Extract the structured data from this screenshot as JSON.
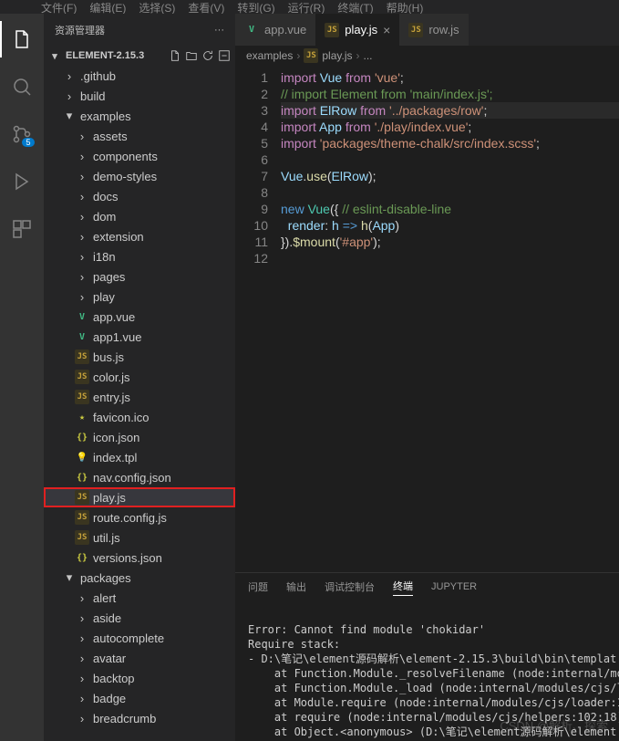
{
  "menubar": [
    "文件(F)",
    "编辑(E)",
    "选择(S)",
    "查看(V)",
    "转到(G)",
    "运行(R)",
    "终端(T)",
    "帮助(H)"
  ],
  "sidebar": {
    "title": "资源管理器",
    "root": "ELEMENT-2.15.3",
    "scm_badge": "5"
  },
  "tree": [
    {
      "depth": 1,
      "kind": "folder",
      "open": false,
      "label": ".github"
    },
    {
      "depth": 1,
      "kind": "folder",
      "open": false,
      "label": "build"
    },
    {
      "depth": 1,
      "kind": "folder",
      "open": true,
      "label": "examples"
    },
    {
      "depth": 2,
      "kind": "folder",
      "open": false,
      "label": "assets"
    },
    {
      "depth": 2,
      "kind": "folder",
      "open": false,
      "label": "components"
    },
    {
      "depth": 2,
      "kind": "folder",
      "open": false,
      "label": "demo-styles"
    },
    {
      "depth": 2,
      "kind": "folder",
      "open": false,
      "label": "docs"
    },
    {
      "depth": 2,
      "kind": "folder",
      "open": false,
      "label": "dom"
    },
    {
      "depth": 2,
      "kind": "folder",
      "open": false,
      "label": "extension"
    },
    {
      "depth": 2,
      "kind": "folder",
      "open": false,
      "label": "i18n"
    },
    {
      "depth": 2,
      "kind": "folder",
      "open": false,
      "label": "pages"
    },
    {
      "depth": 2,
      "kind": "folder",
      "open": false,
      "label": "play"
    },
    {
      "depth": 2,
      "kind": "file",
      "icon": "vue",
      "label": "app.vue"
    },
    {
      "depth": 2,
      "kind": "file",
      "icon": "vue",
      "label": "app1.vue"
    },
    {
      "depth": 2,
      "kind": "file",
      "icon": "js",
      "label": "bus.js"
    },
    {
      "depth": 2,
      "kind": "file",
      "icon": "js",
      "label": "color.js"
    },
    {
      "depth": 2,
      "kind": "file",
      "icon": "js",
      "label": "entry.js"
    },
    {
      "depth": 2,
      "kind": "file",
      "icon": "ico",
      "label": "favicon.ico"
    },
    {
      "depth": 2,
      "kind": "file",
      "icon": "json",
      "label": "icon.json"
    },
    {
      "depth": 2,
      "kind": "file",
      "icon": "bulb",
      "label": "index.tpl"
    },
    {
      "depth": 2,
      "kind": "file",
      "icon": "json",
      "label": "nav.config.json"
    },
    {
      "depth": 2,
      "kind": "file",
      "icon": "js",
      "label": "play.js",
      "selected": true,
      "boxed": true
    },
    {
      "depth": 2,
      "kind": "file",
      "icon": "js",
      "label": "route.config.js"
    },
    {
      "depth": 2,
      "kind": "file",
      "icon": "js",
      "label": "util.js"
    },
    {
      "depth": 2,
      "kind": "file",
      "icon": "json",
      "label": "versions.json"
    },
    {
      "depth": 1,
      "kind": "folder",
      "open": true,
      "label": "packages"
    },
    {
      "depth": 2,
      "kind": "folder",
      "open": false,
      "label": "alert"
    },
    {
      "depth": 2,
      "kind": "folder",
      "open": false,
      "label": "aside"
    },
    {
      "depth": 2,
      "kind": "folder",
      "open": false,
      "label": "autocomplete"
    },
    {
      "depth": 2,
      "kind": "folder",
      "open": false,
      "label": "avatar"
    },
    {
      "depth": 2,
      "kind": "folder",
      "open": false,
      "label": "backtop"
    },
    {
      "depth": 2,
      "kind": "folder",
      "open": false,
      "label": "badge"
    },
    {
      "depth": 2,
      "kind": "folder",
      "open": false,
      "label": "breadcrumb"
    }
  ],
  "tabs": [
    {
      "icon": "vue",
      "label": "app.vue",
      "active": false
    },
    {
      "icon": "js",
      "label": "play.js",
      "active": true,
      "close": true
    },
    {
      "icon": "js",
      "label": "row.js",
      "active": false
    }
  ],
  "breadcrumbs": [
    "examples",
    "play.js",
    "..."
  ],
  "code_lines": [
    {
      "n": 1,
      "html": "<span class='k-import'>import</span> <span class='k-var'>Vue</span> <span class='k-from'>from</span> <span class='k-str'>'vue'</span><span class='k-pun'>;</span>"
    },
    {
      "n": 2,
      "html": "<span class='k-com'>// import Element from 'main/index.js';</span>"
    },
    {
      "n": 3,
      "current": true,
      "html": "<span class='k-import'>import</span> <span class='k-var'>ElRow</span> <span class='k-from'>from</span> <span class='k-str'>'../packages/row'</span><span class='k-pun'>;</span>"
    },
    {
      "n": 4,
      "html": "<span class='k-import'>import</span> <span class='k-var'>App</span> <span class='k-from'>from</span> <span class='k-str'>'./play/index.vue'</span><span class='k-pun'>;</span>"
    },
    {
      "n": 5,
      "html": "<span class='k-import'>import</span> <span class='k-str'>'packages/theme-chalk/src/index.scss'</span><span class='k-pun'>;</span>"
    },
    {
      "n": 6,
      "html": ""
    },
    {
      "n": 7,
      "html": "<span class='k-var'>Vue</span><span class='k-pun'>.</span><span class='k-fn'>use</span><span class='k-pun'>(</span><span class='k-var'>ElRow</span><span class='k-pun'>);</span>"
    },
    {
      "n": 8,
      "html": ""
    },
    {
      "n": 9,
      "html": "<span class='k-new'>new</span> <span class='k-type'>Vue</span><span class='k-pun'>({</span> <span class='k-com'>// eslint-disable-line</span>"
    },
    {
      "n": 10,
      "html": "  <span class='k-prop'>render</span><span class='k-pun'>:</span> <span class='k-var'>h</span> <span class='k-new'>=></span> <span class='k-fn'>h</span><span class='k-pun'>(</span><span class='k-var'>App</span><span class='k-pun'>)</span>"
    },
    {
      "n": 11,
      "html": "<span class='k-pun'>}).</span><span class='k-fn'>$mount</span><span class='k-pun'>(</span><span class='k-str'>'#app'</span><span class='k-pun'>);</span>"
    },
    {
      "n": 12,
      "html": ""
    }
  ],
  "panel": {
    "tabs": [
      "问题",
      "输出",
      "调试控制台",
      "终端",
      "JUPYTER"
    ],
    "active": 3,
    "terminal": "\nError: Cannot find module 'chokidar'\nRequire stack:\n- D:\\笔记\\element源码解析\\element-2.15.3\\build\\bin\\templat\n    at Function.Module._resolveFilename (node:internal/mod\n    at Function.Module._load (node:internal/modules/cjs/lo\n    at Module.require (node:internal/modules/cjs/loader:10\n    at require (node:internal/modules/cjs/helpers:102:18)\n    at Object.<anonymous> (D:\\笔记\\element源码解析\\element"
  },
  "watermark": "CSDN @解析、探索"
}
